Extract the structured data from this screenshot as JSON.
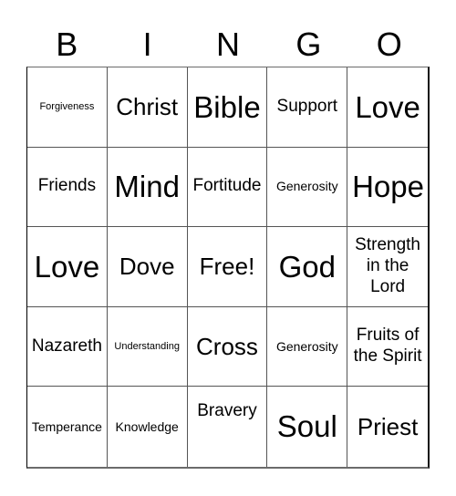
{
  "header": {
    "letters": [
      "B",
      "I",
      "N",
      "G",
      "O"
    ]
  },
  "card": {
    "cells": [
      {
        "text": "Forgiveness",
        "size": "xs"
      },
      {
        "text": "Christ",
        "size": "lg"
      },
      {
        "text": "Bible",
        "size": "xl"
      },
      {
        "text": "Support",
        "size": "md"
      },
      {
        "text": "Love",
        "size": "xl"
      },
      {
        "text": "Friends",
        "size": "md"
      },
      {
        "text": "Mind",
        "size": "xl"
      },
      {
        "text": "Fortitude",
        "size": "md"
      },
      {
        "text": "Generosity",
        "size": "sm"
      },
      {
        "text": "Hope",
        "size": "xl"
      },
      {
        "text": "Love",
        "size": "xl"
      },
      {
        "text": "Dove",
        "size": "lg"
      },
      {
        "text": "Free!",
        "size": "lg"
      },
      {
        "text": "God",
        "size": "xl"
      },
      {
        "text": "Strength in the Lord",
        "size": "md"
      },
      {
        "text": "Nazareth",
        "size": "md"
      },
      {
        "text": "Understanding",
        "size": "xs"
      },
      {
        "text": "Cross",
        "size": "lg"
      },
      {
        "text": "Generosity",
        "size": "sm"
      },
      {
        "text": "Fruits of the Spirit",
        "size": "md"
      },
      {
        "text": "Temperance",
        "size": "sm"
      },
      {
        "text": "Knowledge",
        "size": "sm"
      },
      {
        "text": "Bravery",
        "size": "md",
        "align": "top"
      },
      {
        "text": "Soul",
        "size": "xl"
      },
      {
        "text": "Priest",
        "size": "lg"
      }
    ]
  }
}
